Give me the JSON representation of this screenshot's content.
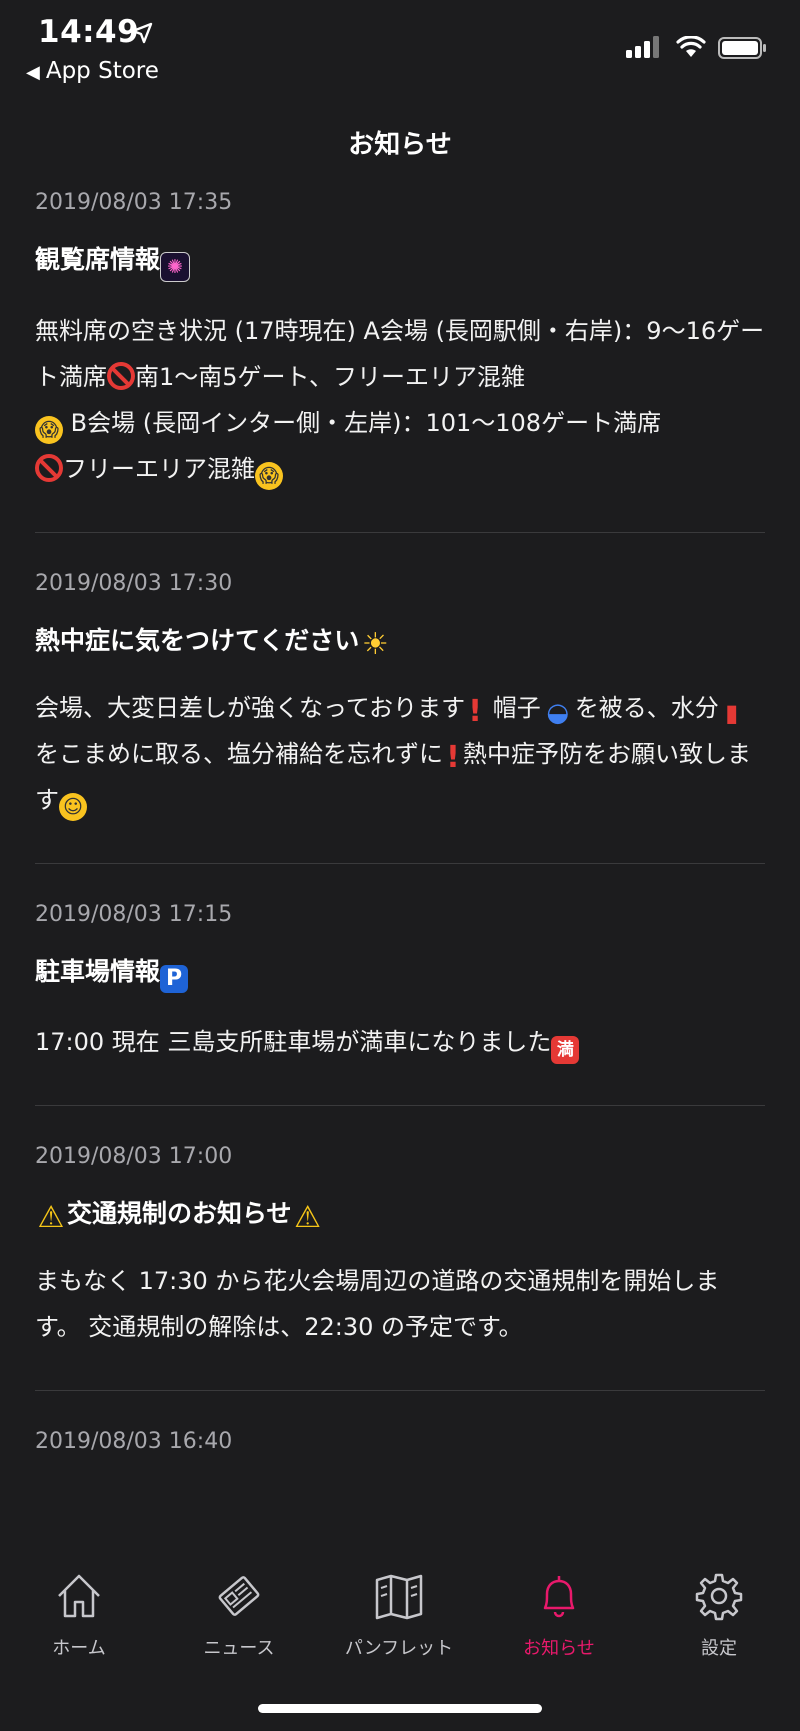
{
  "status": {
    "time": "14:49",
    "back_label": "App Store"
  },
  "page_title": "お知らせ",
  "items": [
    {
      "date": "2019/08/03 17:35",
      "title": "観覧席情報",
      "body": {
        "t1": "無料席の空き状況 (17時現在) A会場 (長岡駅側・右岸)：9〜16ゲート満席",
        "t2": "南1〜南5ゲート、フリーエリア混雑",
        "t3": " B会場 (長岡インター側・左岸)：101〜108ゲート満席",
        "t4": "フリーエリア混雑"
      }
    },
    {
      "date": "2019/08/03 17:30",
      "title": "熱中症に気をつけてください",
      "body": {
        "t1": "会場、大変日差しが強くなっております",
        "t2": " 帽子",
        "t3": "を被る、水分",
        "t4": "をこまめに取る、塩分補給を忘れずに",
        "t5": "熱中症予防をお願い致します"
      }
    },
    {
      "date": "2019/08/03 17:15",
      "title": "駐車場情報",
      "body": {
        "t1": "17:00 現在 三島支所駐車場が満車になりました"
      }
    },
    {
      "date": "2019/08/03 17:00",
      "title": "交通規制のお知らせ",
      "body": {
        "t1": "まもなく 17:30 から花火会場周辺の道路の交通規制を開始します。 交通規制の解除は、22:30 の予定です。"
      }
    },
    {
      "date": "2019/08/03 16:40"
    }
  ],
  "emoji": {
    "parking": "P",
    "full": "満"
  },
  "tabbar": {
    "tabs": [
      {
        "label": "ホーム",
        "icon": "home-icon"
      },
      {
        "label": "ニュース",
        "icon": "news-icon"
      },
      {
        "label": "パンフレット",
        "icon": "pamphlet-icon"
      },
      {
        "label": "お知らせ",
        "icon": "bell-icon"
      },
      {
        "label": "設定",
        "icon": "gear-icon"
      }
    ],
    "active_index": 3,
    "active_color": "#e8196b"
  }
}
